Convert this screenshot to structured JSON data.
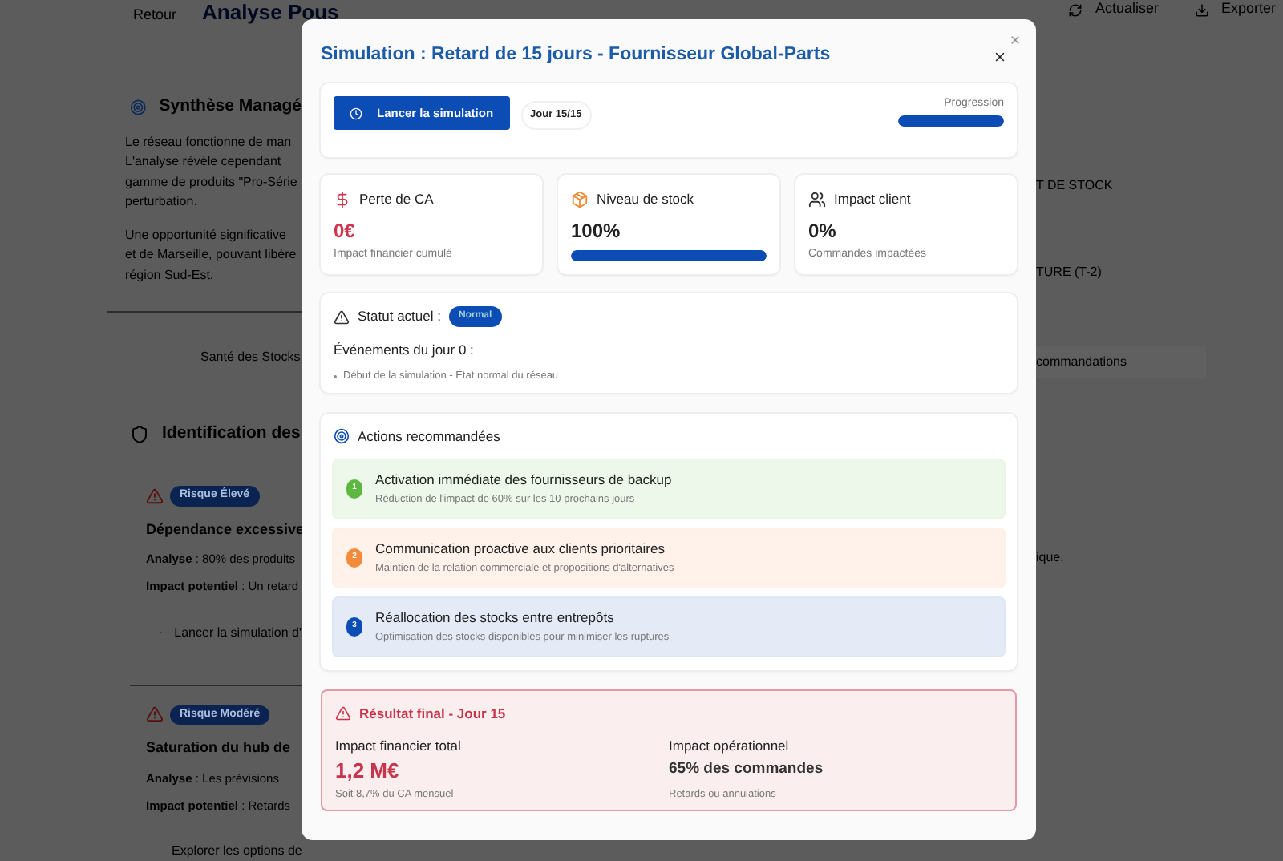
{
  "background": {
    "back_label": "Retour",
    "title": "Analyse Pous",
    "actions": [
      "Actualiser",
      "Exporter"
    ],
    "summary": {
      "heading": "Synthèse Managé",
      "lines": [
        "Le réseau fonctionne de man",
        "L'analyse révèle cependant",
        "gamme de produits \"Pro-Série",
        "perturbation.",
        "Une opportunité significative",
        "et de Marseille, pouvant libére",
        "région Sud-Est."
      ]
    },
    "tab_label": "Santé des Stocks",
    "risks": {
      "heading": "Identification des",
      "items": [
        {
          "badge": "Risque Élevé",
          "title": "Dépendance excessive",
          "analysis": "**Analyse** : 80% des produits",
          "impact": "**Impact potentiel** : Un retard",
          "action": "Lancer la simulation d'"
        },
        {
          "badge": "Risque Modéré",
          "title": "Saturation du hub de",
          "analysis": "**Analyse** : Les prévisions",
          "impact": "**Impact potentiel** : Retards",
          "action": "Explorer les options de"
        }
      ]
    },
    "right_fragments": [
      {
        "text": "T DE STOCK",
        "kind": "plain"
      },
      {
        "text": "TURE (T-2)",
        "kind": "plain"
      },
      {
        "text": "commandations",
        "kind": "tab"
      },
      {
        "text": "ique.",
        "kind": "plain"
      }
    ]
  },
  "modal": {
    "title": "Simulation : Retard de 15 jours - Fournisseur Global-Parts",
    "controls": {
      "button": "Lancer la simulation",
      "day": "Jour 15/15",
      "progress_label": "Progression",
      "level": 1
    },
    "metrics": [
      {
        "kind": "money",
        "label": "Perte de CA",
        "value": "0€",
        "caption": "Impact financier cumulé"
      },
      {
        "kind": "stock",
        "label": "Niveau de stock",
        "value": "100%",
        "level": 1
      },
      {
        "kind": "clients",
        "label": "Impact client",
        "value": "0%",
        "caption": "Commandes impactées"
      }
    ],
    "status": {
      "label": "Statut actuel :",
      "badge": "Normal",
      "events_title": "Événements du jour 0 :",
      "events": [
        "Début de la simulation - État normal du réseau"
      ]
    },
    "actions": {
      "heading": "Actions recommandées",
      "items": [
        {
          "number": "1",
          "title": "Activation immédiate des fournisseurs de backup",
          "detail": "Réduction de l'impact de 60% sur les 10 prochains jours",
          "color": "#5cb83f"
        },
        {
          "number": "2",
          "title": "Communication proactive aux clients prioritaires",
          "detail": "Maintien de la relation commerciale et propositions d'alternatives",
          "color": "#f28b3c"
        },
        {
          "number": "3",
          "title": "Réallocation des stocks entre entrepôts",
          "detail": "Optimisation des stocks disponibles pour minimiser les ruptures",
          "color": "#0b4db5"
        }
      ]
    },
    "final": {
      "title": "Résultat final - Jour 15",
      "columns": [
        {
          "label": "Impact financier total",
          "value": "1,2 M€",
          "caption": "Soit 8,7% du CA mensuel",
          "kind": "money"
        },
        {
          "label": "Impact opérationnel",
          "value": "65% des commandes",
          "caption": "Retards ou annulations",
          "kind": "ops"
        }
      ]
    }
  }
}
